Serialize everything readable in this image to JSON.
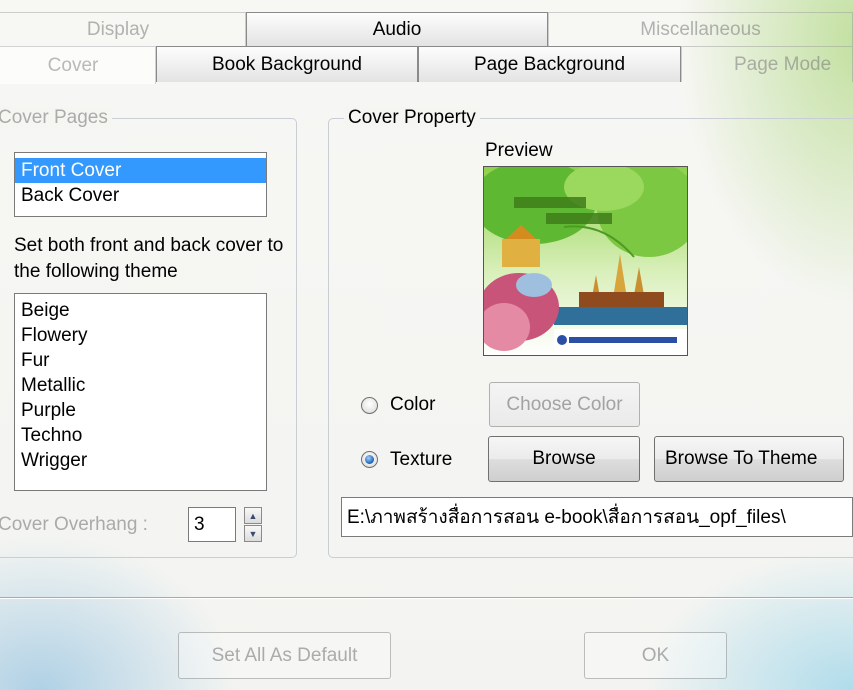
{
  "tabs_row1": [
    "Display",
    "Audio",
    "Miscellaneous"
  ],
  "tabs_row2": [
    "Cover",
    "Book Background",
    "Page Background",
    "Page Mode"
  ],
  "cover_pages": {
    "legend": "Cover Pages",
    "items": [
      "Front Cover",
      "Back Cover"
    ],
    "selected": "Front Cover"
  },
  "theme_prompt": "Set both front and back cover to the following theme",
  "themes": [
    "Beige",
    "Flowery",
    "Fur",
    "Metallic",
    "Purple",
    "Techno",
    "Wrigger"
  ],
  "overhang": {
    "label": "Cover Overhang :",
    "value": "3"
  },
  "cover_property": {
    "legend": "Cover Property",
    "preview_label": "Preview",
    "color_label": "Color",
    "choose_color_label": "Choose Color",
    "texture_label": "Texture",
    "browse_label": "Browse",
    "browse_theme_label": "Browse To Theme",
    "selected_option": "Texture",
    "path": "E:\\ภาพสร้างสื่อการสอน e-book\\สื่อการสอน_opf_files\\"
  },
  "footer": {
    "default_label": "Set All As Default",
    "ok_label": "OK"
  },
  "colors": {
    "selection": "#3399ff",
    "group_border": "#c9cdd6"
  }
}
